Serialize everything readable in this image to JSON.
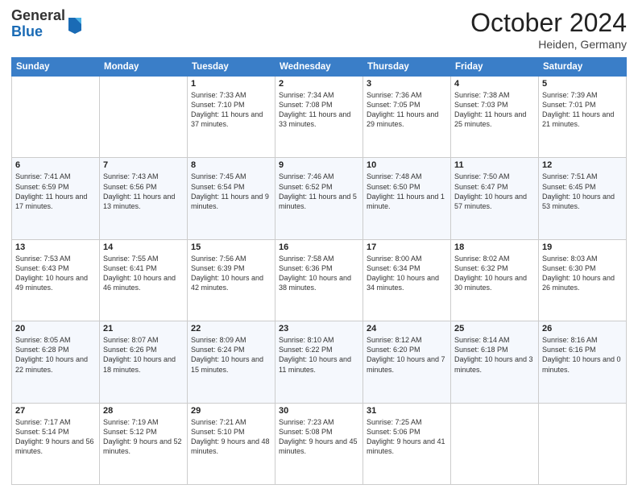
{
  "logo": {
    "general": "General",
    "blue": "Blue"
  },
  "header": {
    "month": "October 2024",
    "location": "Heiden, Germany"
  },
  "weekdays": [
    "Sunday",
    "Monday",
    "Tuesday",
    "Wednesday",
    "Thursday",
    "Friday",
    "Saturday"
  ],
  "weeks": [
    [
      {
        "day": "",
        "sunrise": "",
        "sunset": "",
        "daylight": ""
      },
      {
        "day": "",
        "sunrise": "",
        "sunset": "",
        "daylight": ""
      },
      {
        "day": "1",
        "sunrise": "Sunrise: 7:33 AM",
        "sunset": "Sunset: 7:10 PM",
        "daylight": "Daylight: 11 hours and 37 minutes."
      },
      {
        "day": "2",
        "sunrise": "Sunrise: 7:34 AM",
        "sunset": "Sunset: 7:08 PM",
        "daylight": "Daylight: 11 hours and 33 minutes."
      },
      {
        "day": "3",
        "sunrise": "Sunrise: 7:36 AM",
        "sunset": "Sunset: 7:05 PM",
        "daylight": "Daylight: 11 hours and 29 minutes."
      },
      {
        "day": "4",
        "sunrise": "Sunrise: 7:38 AM",
        "sunset": "Sunset: 7:03 PM",
        "daylight": "Daylight: 11 hours and 25 minutes."
      },
      {
        "day": "5",
        "sunrise": "Sunrise: 7:39 AM",
        "sunset": "Sunset: 7:01 PM",
        "daylight": "Daylight: 11 hours and 21 minutes."
      }
    ],
    [
      {
        "day": "6",
        "sunrise": "Sunrise: 7:41 AM",
        "sunset": "Sunset: 6:59 PM",
        "daylight": "Daylight: 11 hours and 17 minutes."
      },
      {
        "day": "7",
        "sunrise": "Sunrise: 7:43 AM",
        "sunset": "Sunset: 6:56 PM",
        "daylight": "Daylight: 11 hours and 13 minutes."
      },
      {
        "day": "8",
        "sunrise": "Sunrise: 7:45 AM",
        "sunset": "Sunset: 6:54 PM",
        "daylight": "Daylight: 11 hours and 9 minutes."
      },
      {
        "day": "9",
        "sunrise": "Sunrise: 7:46 AM",
        "sunset": "Sunset: 6:52 PM",
        "daylight": "Daylight: 11 hours and 5 minutes."
      },
      {
        "day": "10",
        "sunrise": "Sunrise: 7:48 AM",
        "sunset": "Sunset: 6:50 PM",
        "daylight": "Daylight: 11 hours and 1 minute."
      },
      {
        "day": "11",
        "sunrise": "Sunrise: 7:50 AM",
        "sunset": "Sunset: 6:47 PM",
        "daylight": "Daylight: 10 hours and 57 minutes."
      },
      {
        "day": "12",
        "sunrise": "Sunrise: 7:51 AM",
        "sunset": "Sunset: 6:45 PM",
        "daylight": "Daylight: 10 hours and 53 minutes."
      }
    ],
    [
      {
        "day": "13",
        "sunrise": "Sunrise: 7:53 AM",
        "sunset": "Sunset: 6:43 PM",
        "daylight": "Daylight: 10 hours and 49 minutes."
      },
      {
        "day": "14",
        "sunrise": "Sunrise: 7:55 AM",
        "sunset": "Sunset: 6:41 PM",
        "daylight": "Daylight: 10 hours and 46 minutes."
      },
      {
        "day": "15",
        "sunrise": "Sunrise: 7:56 AM",
        "sunset": "Sunset: 6:39 PM",
        "daylight": "Daylight: 10 hours and 42 minutes."
      },
      {
        "day": "16",
        "sunrise": "Sunrise: 7:58 AM",
        "sunset": "Sunset: 6:36 PM",
        "daylight": "Daylight: 10 hours and 38 minutes."
      },
      {
        "day": "17",
        "sunrise": "Sunrise: 8:00 AM",
        "sunset": "Sunset: 6:34 PM",
        "daylight": "Daylight: 10 hours and 34 minutes."
      },
      {
        "day": "18",
        "sunrise": "Sunrise: 8:02 AM",
        "sunset": "Sunset: 6:32 PM",
        "daylight": "Daylight: 10 hours and 30 minutes."
      },
      {
        "day": "19",
        "sunrise": "Sunrise: 8:03 AM",
        "sunset": "Sunset: 6:30 PM",
        "daylight": "Daylight: 10 hours and 26 minutes."
      }
    ],
    [
      {
        "day": "20",
        "sunrise": "Sunrise: 8:05 AM",
        "sunset": "Sunset: 6:28 PM",
        "daylight": "Daylight: 10 hours and 22 minutes."
      },
      {
        "day": "21",
        "sunrise": "Sunrise: 8:07 AM",
        "sunset": "Sunset: 6:26 PM",
        "daylight": "Daylight: 10 hours and 18 minutes."
      },
      {
        "day": "22",
        "sunrise": "Sunrise: 8:09 AM",
        "sunset": "Sunset: 6:24 PM",
        "daylight": "Daylight: 10 hours and 15 minutes."
      },
      {
        "day": "23",
        "sunrise": "Sunrise: 8:10 AM",
        "sunset": "Sunset: 6:22 PM",
        "daylight": "Daylight: 10 hours and 11 minutes."
      },
      {
        "day": "24",
        "sunrise": "Sunrise: 8:12 AM",
        "sunset": "Sunset: 6:20 PM",
        "daylight": "Daylight: 10 hours and 7 minutes."
      },
      {
        "day": "25",
        "sunrise": "Sunrise: 8:14 AM",
        "sunset": "Sunset: 6:18 PM",
        "daylight": "Daylight: 10 hours and 3 minutes."
      },
      {
        "day": "26",
        "sunrise": "Sunrise: 8:16 AM",
        "sunset": "Sunset: 6:16 PM",
        "daylight": "Daylight: 10 hours and 0 minutes."
      }
    ],
    [
      {
        "day": "27",
        "sunrise": "Sunrise: 7:17 AM",
        "sunset": "Sunset: 5:14 PM",
        "daylight": "Daylight: 9 hours and 56 minutes."
      },
      {
        "day": "28",
        "sunrise": "Sunrise: 7:19 AM",
        "sunset": "Sunset: 5:12 PM",
        "daylight": "Daylight: 9 hours and 52 minutes."
      },
      {
        "day": "29",
        "sunrise": "Sunrise: 7:21 AM",
        "sunset": "Sunset: 5:10 PM",
        "daylight": "Daylight: 9 hours and 48 minutes."
      },
      {
        "day": "30",
        "sunrise": "Sunrise: 7:23 AM",
        "sunset": "Sunset: 5:08 PM",
        "daylight": "Daylight: 9 hours and 45 minutes."
      },
      {
        "day": "31",
        "sunrise": "Sunrise: 7:25 AM",
        "sunset": "Sunset: 5:06 PM",
        "daylight": "Daylight: 9 hours and 41 minutes."
      },
      {
        "day": "",
        "sunrise": "",
        "sunset": "",
        "daylight": ""
      },
      {
        "day": "",
        "sunrise": "",
        "sunset": "",
        "daylight": ""
      }
    ]
  ]
}
